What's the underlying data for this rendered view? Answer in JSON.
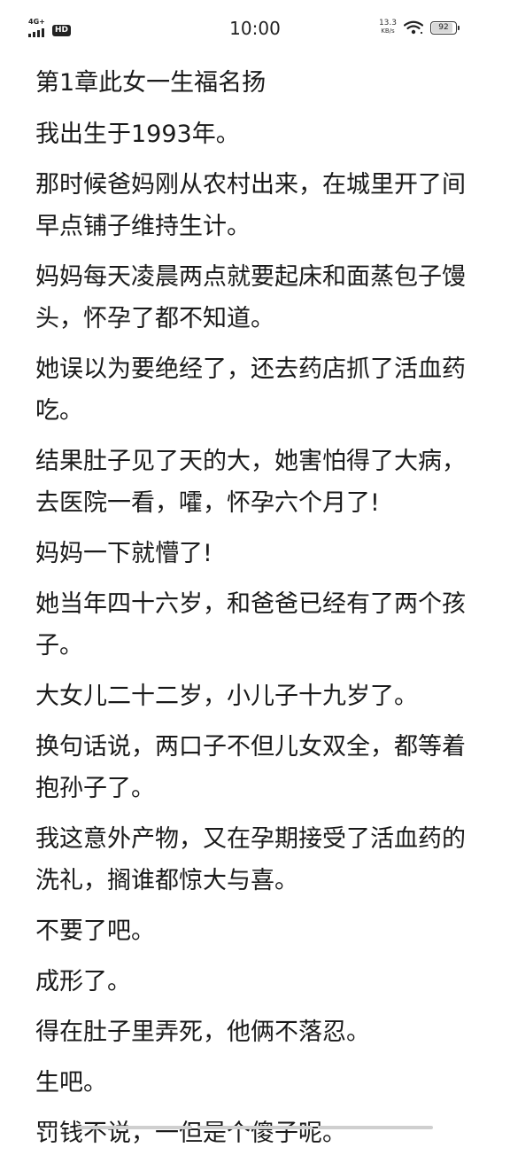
{
  "status_bar": {
    "network": "4G+",
    "hd": "HD",
    "time": "10:00",
    "net_speed_value": "13.3",
    "net_speed_unit": "KB/s",
    "battery_level": "92",
    "battery_fraction": 0.92,
    "icons": [
      "signal-icon",
      "wifi-icon",
      "battery-icon"
    ]
  },
  "reader": {
    "chapter_title": "第1章此女一生福名扬",
    "paragraphs": [
      "我出生于1993年。",
      "那时候爸妈刚从农村出来，在城里开了间早点铺子维持生计。",
      "妈妈每天凌晨两点就要起床和面蒸包子馒头，怀孕了都不知道。",
      "她误以为要绝经了，还去药店抓了活血药吃。",
      "结果肚子见了天的大，她害怕得了大病，去医院一看，嚯，怀孕六个月了!",
      "妈妈一下就懵了!",
      "她当年四十六岁，和爸爸已经有了两个孩子。",
      "大女儿二十二岁，小儿子十九岁了。",
      "换句话说，两口子不但儿女双全，都等着抱孙子了。",
      "我这意外产物，又在孕期接受了活血药的洗礼，搁谁都惊大与喜。",
      "不要了吧。",
      "成形了。",
      "得在肚子里弄死，他俩不落忍。",
      "生吧。",
      "罚钱不说，一但是个傻子呢。"
    ]
  }
}
